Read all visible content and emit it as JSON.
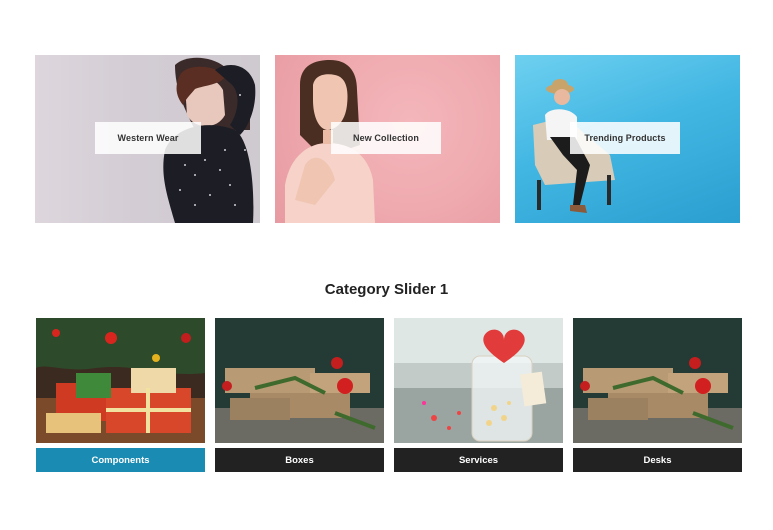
{
  "banners": [
    {
      "label": "Western Wear"
    },
    {
      "label": "New Collection"
    },
    {
      "label": "Trending Products"
    }
  ],
  "category_slider": {
    "title": "Category Slider 1",
    "items": [
      {
        "label": "Components",
        "active": true
      },
      {
        "label": "Boxes",
        "active": false
      },
      {
        "label": "Services",
        "active": false
      },
      {
        "label": "Desks",
        "active": false
      }
    ]
  },
  "colors": {
    "active_button": "#1a8bb3",
    "button": "#222222"
  }
}
